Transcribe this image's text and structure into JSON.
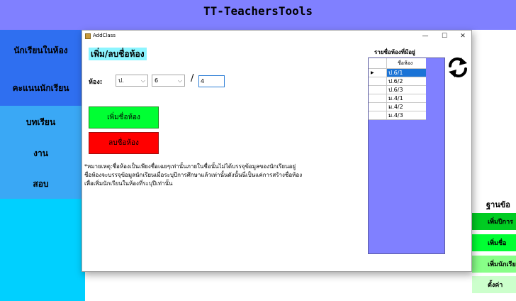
{
  "app": {
    "title": "TT-TeachersTools"
  },
  "sidebar": {
    "items": [
      {
        "label": "นักเรียนในห้อง",
        "color": "#2f6ff0"
      },
      {
        "label": "คะแนนนักเรียน",
        "color": "#2f6ff0"
      },
      {
        "label": "บทเรียน",
        "color": "#3aa8f5"
      },
      {
        "label": "งาน",
        "color": "#3aa8f5"
      },
      {
        "label": "สอบ",
        "color": "#3aa8f5"
      }
    ]
  },
  "right_panel": {
    "title": "ฐานข้อ",
    "buttons": [
      {
        "label": "เพิ่มปีการ",
        "color": "#00cc22"
      },
      {
        "label": "เพิ่มชื่อ",
        "color": "#00ff33"
      },
      {
        "label": "เพิ่มนักเรียน",
        "color": "#88ff88"
      },
      {
        "label": "ตั้งค่า",
        "color": "#ccffcc"
      }
    ]
  },
  "dialog": {
    "title": "AddClass",
    "controls": {
      "minimize": "—",
      "maximize": "☐",
      "close": "✕"
    },
    "heading": "เพิ่ม/ลบชื่อห้อง",
    "room_label": "ห้อง:",
    "level_select": {
      "value": "ป."
    },
    "grade_select": {
      "value": "6"
    },
    "separator": "/",
    "room_number": "4",
    "add_button": "เพิ่มชื่อห้อง",
    "delete_button": "ลบชื่อห้อง",
    "note": [
      "*หมายเหตุ:ชื่อห้องเป็นเพียงชื่อเฉยๆเท่านั้นภายในชื่อนั้นไม่ได้บรรจุข้อมูลของนักเรียนอยู่",
      "ชื่อห้องจะบรรจุข้อมูลนักเรียนเมื่อระบุปีการศึกษาแล้วเท่านั้นดังนั้นนี่เป็นแค่การสร้างชื่อห้อง",
      "เพื่อเพิ่มนักเรียนในห้องที่ระบุปีเท่านั้น"
    ],
    "list_title": "รายชื่อห้องที่มีอยู่",
    "grid": {
      "column": "ชื่อห้อง",
      "current_marker": "▶",
      "rows": [
        "ป.6/1",
        "ป.6/2",
        "ป.6/3",
        "ม.4/1",
        "ม.4/2",
        "ม.4/3"
      ],
      "selected_index": 0
    }
  }
}
